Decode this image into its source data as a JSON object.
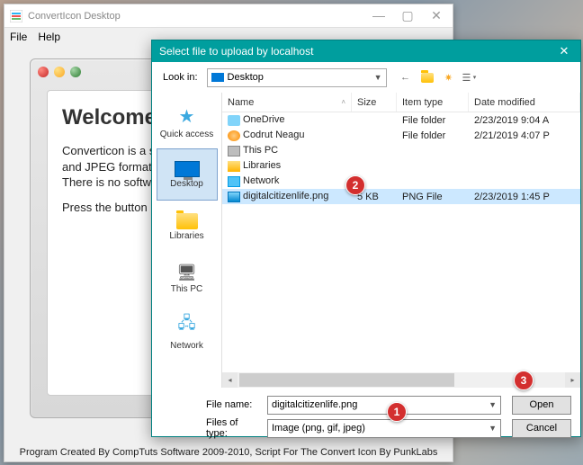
{
  "main_window": {
    "title": "ConvertIcon Desktop",
    "menu": {
      "file": "File",
      "help": "Help"
    },
    "card": {
      "heading": "Welcome",
      "para1": "Converticon is a simple icon utility. It can import ICO, PNG, GIF, and JPEG formats and export to high-quality PNG or ICO files. There is no software to download,",
      "para2": "Press the button below to get started."
    },
    "footer": "Program Created By CompTuts Software 2009-2010, Script For The Convert Icon By PunkLabs"
  },
  "dialog": {
    "title": "Select file to upload by localhost",
    "look_in_label": "Look in:",
    "look_in_value": "Desktop",
    "places": [
      {
        "label": "Quick access"
      },
      {
        "label": "Desktop"
      },
      {
        "label": "Libraries"
      },
      {
        "label": "This PC"
      },
      {
        "label": "Network"
      }
    ],
    "columns": {
      "name": "Name",
      "size": "Size",
      "type": "Item type",
      "date": "Date modified"
    },
    "rows": [
      {
        "name": "OneDrive",
        "size": "",
        "type": "File folder",
        "date": "2/23/2019 9:04 A"
      },
      {
        "name": "Codrut Neagu",
        "size": "",
        "type": "File folder",
        "date": "2/21/2019 4:07 P"
      },
      {
        "name": "This PC",
        "size": "",
        "type": "",
        "date": ""
      },
      {
        "name": "Libraries",
        "size": "",
        "type": "",
        "date": ""
      },
      {
        "name": "Network",
        "size": "",
        "type": "",
        "date": ""
      },
      {
        "name": "digitalcitizenlife.png",
        "size": "5 KB",
        "type": "PNG File",
        "date": "2/23/2019 1:45 P"
      }
    ],
    "file_name_label": "File name:",
    "file_name_value": "digitalcitizenlife.png",
    "file_type_label": "Files of type:",
    "file_type_value": "Image (png, gif, jpeg)",
    "buttons": {
      "open": "Open",
      "cancel": "Cancel"
    }
  },
  "callouts": {
    "c1": "1",
    "c2": "2",
    "c3": "3"
  }
}
